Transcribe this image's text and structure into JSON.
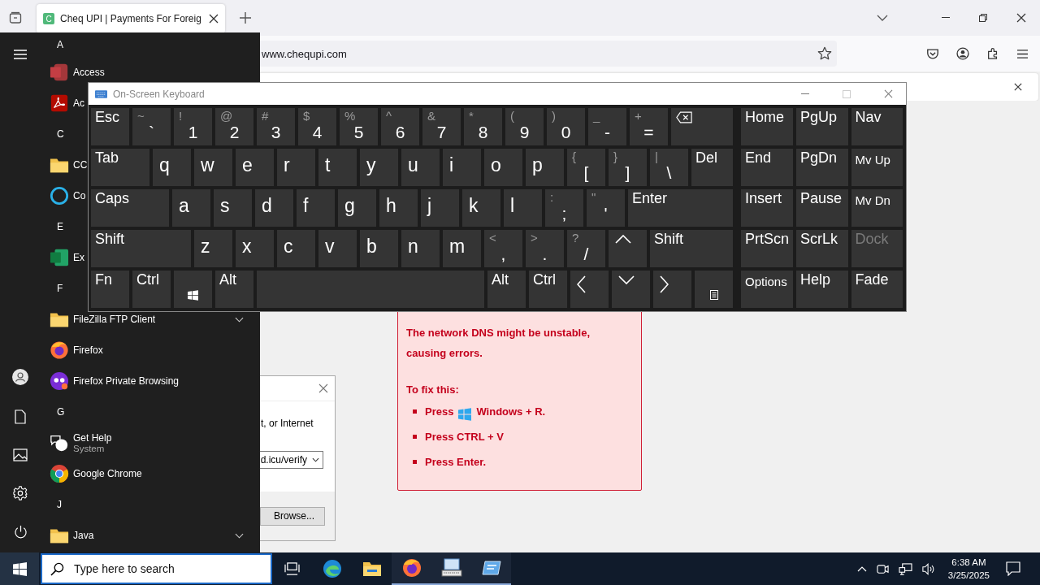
{
  "browser": {
    "tab": {
      "favicon": "C",
      "title": "Cheq UPI | Payments For Foreig",
      "selected": true
    },
    "url": "www.chequpi.com"
  },
  "start_menu": {
    "sections": [
      {
        "letter": "A",
        "items": [
          {
            "kind": "access",
            "name": "Access"
          },
          {
            "kind": "acrobat",
            "name": "Ac"
          }
        ]
      },
      {
        "letter": "C",
        "items": [
          {
            "kind": "folder",
            "name": "CC"
          },
          {
            "kind": "cortana",
            "name": "Co"
          }
        ]
      },
      {
        "letter": "E",
        "items": [
          {
            "kind": "excel",
            "name": "Ex"
          }
        ]
      },
      {
        "letter": "F",
        "items": [
          {
            "kind": "group",
            "name": "FileZilla FTP Client"
          },
          {
            "kind": "firefox",
            "name": "Firefox"
          },
          {
            "kind": "private",
            "name": "Firefox Private Browsing"
          }
        ]
      },
      {
        "letter": "G",
        "items": [
          {
            "kind": "help",
            "name": "Get Help",
            "subtitle": "System"
          },
          {
            "kind": "chrome",
            "name": "Google Chrome"
          }
        ]
      },
      {
        "letter": "J",
        "items": [
          {
            "kind": "group",
            "name": "Java"
          }
        ]
      }
    ]
  },
  "keyboard": {
    "title": "On-Screen Keyboard",
    "key_rows": [
      {
        "keys": [
          {
            "kind": "word",
            "label": "Esc"
          },
          {
            "kind": "char",
            "shift": "~",
            "label": "`"
          },
          {
            "kind": "char",
            "shift": "!",
            "label": "1"
          },
          {
            "kind": "char",
            "shift": "@",
            "label": "2"
          },
          {
            "kind": "char",
            "shift": "#",
            "label": "3"
          },
          {
            "kind": "char",
            "shift": "$",
            "label": "4"
          },
          {
            "kind": "char",
            "shift": "%",
            "label": "5"
          },
          {
            "kind": "char",
            "shift": "^",
            "label": "6"
          },
          {
            "kind": "char",
            "shift": "&",
            "label": "7"
          },
          {
            "kind": "char",
            "shift": "*",
            "label": "8"
          },
          {
            "kind": "char",
            "shift": "(",
            "label": "9"
          },
          {
            "kind": "char",
            "shift": ")",
            "label": "0"
          },
          {
            "kind": "char",
            "shift": "_",
            "label": "-"
          },
          {
            "kind": "char",
            "shift": "+",
            "label": "="
          },
          {
            "kind": "backspace"
          }
        ]
      },
      {
        "keys": [
          {
            "kind": "word",
            "label": "Tab"
          },
          {
            "kind": "letter",
            "label": "q"
          },
          {
            "kind": "letter",
            "label": "w"
          },
          {
            "kind": "letter",
            "label": "e"
          },
          {
            "kind": "letter",
            "label": "r"
          },
          {
            "kind": "letter",
            "label": "t"
          },
          {
            "kind": "letter",
            "label": "y"
          },
          {
            "kind": "letter",
            "label": "u"
          },
          {
            "kind": "letter",
            "label": "i"
          },
          {
            "kind": "letter",
            "label": "o"
          },
          {
            "kind": "letter",
            "label": "p"
          },
          {
            "kind": "char",
            "shift": "{",
            "label": "["
          },
          {
            "kind": "char",
            "shift": "}",
            "label": "]"
          },
          {
            "kind": "char",
            "shift": "|",
            "label": "\\"
          },
          {
            "kind": "word",
            "label": "Del"
          }
        ]
      },
      {
        "keys": [
          {
            "kind": "word",
            "label": "Caps"
          },
          {
            "kind": "letter",
            "label": "a"
          },
          {
            "kind": "letter",
            "label": "s"
          },
          {
            "kind": "letter",
            "label": "d"
          },
          {
            "kind": "letter",
            "label": "f"
          },
          {
            "kind": "letter",
            "label": "g"
          },
          {
            "kind": "letter",
            "label": "h"
          },
          {
            "kind": "letter",
            "label": "j"
          },
          {
            "kind": "letter",
            "label": "k"
          },
          {
            "kind": "letter",
            "label": "l"
          },
          {
            "kind": "char",
            "shift": ":",
            "label": ";"
          },
          {
            "kind": "char",
            "shift": "\"",
            "label": "'"
          },
          {
            "kind": "word",
            "label": "Enter"
          }
        ]
      },
      {
        "keys": [
          {
            "kind": "word",
            "label": "Shift"
          },
          {
            "kind": "letter",
            "label": "z"
          },
          {
            "kind": "letter",
            "label": "x"
          },
          {
            "kind": "letter",
            "label": "c"
          },
          {
            "kind": "letter",
            "label": "v"
          },
          {
            "kind": "letter",
            "label": "b"
          },
          {
            "kind": "letter",
            "label": "n"
          },
          {
            "kind": "letter",
            "label": "m"
          },
          {
            "kind": "char",
            "shift": "<",
            "label": ","
          },
          {
            "kind": "char",
            "shift": ">",
            "label": "."
          },
          {
            "kind": "char",
            "shift": "?",
            "label": "/"
          },
          {
            "kind": "up"
          },
          {
            "kind": "word",
            "label": "Shift"
          }
        ]
      },
      {
        "keys": [
          {
            "kind": "word",
            "label": "Fn"
          },
          {
            "kind": "word",
            "label": "Ctrl"
          },
          {
            "kind": "windows"
          },
          {
            "kind": "word",
            "label": "Alt"
          },
          {
            "kind": "space"
          },
          {
            "kind": "word",
            "label": "Alt"
          },
          {
            "kind": "word",
            "label": "Ctrl"
          },
          {
            "kind": "left"
          },
          {
            "kind": "down"
          },
          {
            "kind": "right"
          },
          {
            "kind": "menu"
          }
        ]
      }
    ],
    "nav_keys": [
      {
        "kind": "word",
        "label": "Home",
        "disabled": false
      },
      {
        "kind": "word",
        "label": "PgUp",
        "disabled": false
      },
      {
        "kind": "word",
        "label": "Nav",
        "disabled": false
      },
      {
        "kind": "word",
        "label": "End",
        "disabled": false
      },
      {
        "kind": "word",
        "label": "PgDn",
        "disabled": false
      },
      {
        "kind": "small",
        "label": "Mv Up",
        "disabled": false
      },
      {
        "kind": "word",
        "label": "Insert",
        "disabled": false
      },
      {
        "kind": "word",
        "label": "Pause",
        "disabled": false
      },
      {
        "kind": "small",
        "label": "Mv Dn",
        "disabled": false
      },
      {
        "kind": "word",
        "label": "PrtScn",
        "disabled": false
      },
      {
        "kind": "word",
        "label": "ScrLk",
        "disabled": false
      },
      {
        "kind": "word",
        "label": "Dock",
        "disabled": true
      },
      {
        "kind": "small",
        "label": "Options",
        "disabled": false
      },
      {
        "kind": "word",
        "label": "Help",
        "disabled": false
      },
      {
        "kind": "word",
        "label": "Fade",
        "disabled": false
      }
    ]
  },
  "warning": {
    "message": "The network DNS might be unstable, causing errors.",
    "fix_title": "To fix this:",
    "steps": [
      {
        "kind": "winkey",
        "before": "Press",
        "after": "Windows + R."
      },
      {
        "kind": "text",
        "text": "Press CTRL + V"
      },
      {
        "kind": "text",
        "text": "Press Enter."
      }
    ]
  },
  "run_dialog": {
    "text": "t, or Internet",
    "open_value": "d.icu/verify",
    "browse_button": "Browse..."
  },
  "taskbar": {
    "search_placeholder": "Type here to search",
    "apps": [
      {
        "kind": "taskview",
        "running": false
      },
      {
        "kind": "edge",
        "running": false
      },
      {
        "kind": "explorer",
        "running": false
      },
      {
        "kind": "firefox",
        "running": true
      },
      {
        "kind": "keyboard",
        "running": true
      },
      {
        "kind": "app",
        "running": true
      }
    ],
    "time": "6:38 AM",
    "date": "3/25/2025"
  }
}
